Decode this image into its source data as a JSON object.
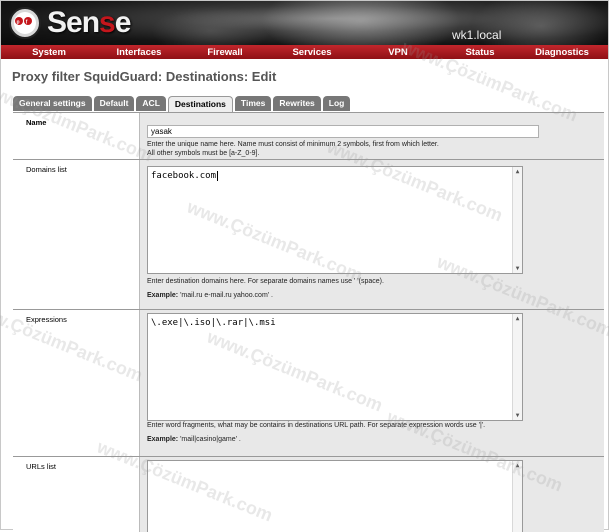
{
  "header": {
    "logo_prefix": "Sen",
    "logo_accent": "s",
    "logo_suffix": "e",
    "logo_full": "pfSense",
    "hostname": "wk1.local"
  },
  "nav": {
    "items": [
      "System",
      "Interfaces",
      "Firewall",
      "Services",
      "VPN",
      "Status",
      "Diagnostics"
    ]
  },
  "page": {
    "title": "Proxy filter SquidGuard: Destinations: Edit"
  },
  "tabs": {
    "items": [
      "General settings",
      "Default",
      "ACL",
      "Destinations",
      "Times",
      "Rewrites",
      "Log"
    ],
    "active": "Destinations"
  },
  "form": {
    "name": {
      "label": "Name",
      "value": "yasak",
      "help_line1": "Enter the unique name here. Name must consist of minimum 2 symbols, first from which letter.",
      "help_line2": "All other symbols must be [a-Z_0-9]."
    },
    "domains": {
      "label": "Domains list",
      "value": "facebook.com",
      "help": "Enter destination domains here. For separate domains names use ' '(space).",
      "example_label": "Example:",
      "example_value": "'mail.ru e-mail.ru yahoo.com' ."
    },
    "expressions": {
      "label": "Expressions",
      "value": "\\.exe|\\.iso|\\.rar|\\.msi",
      "help": "Enter word fragments, what may be contains in destinations URL path. For separate expression words use '|'.",
      "example_label": "Example:",
      "example_value": "'mail|casino|game' ."
    },
    "urls": {
      "label": "URLs list",
      "value": ""
    }
  },
  "watermark": {
    "text": "www.ÇözümPark.com"
  },
  "colors": {
    "nav_red": "#b01a20",
    "tab_gray": "#777777",
    "panel_gray": "#e8e8e8"
  }
}
